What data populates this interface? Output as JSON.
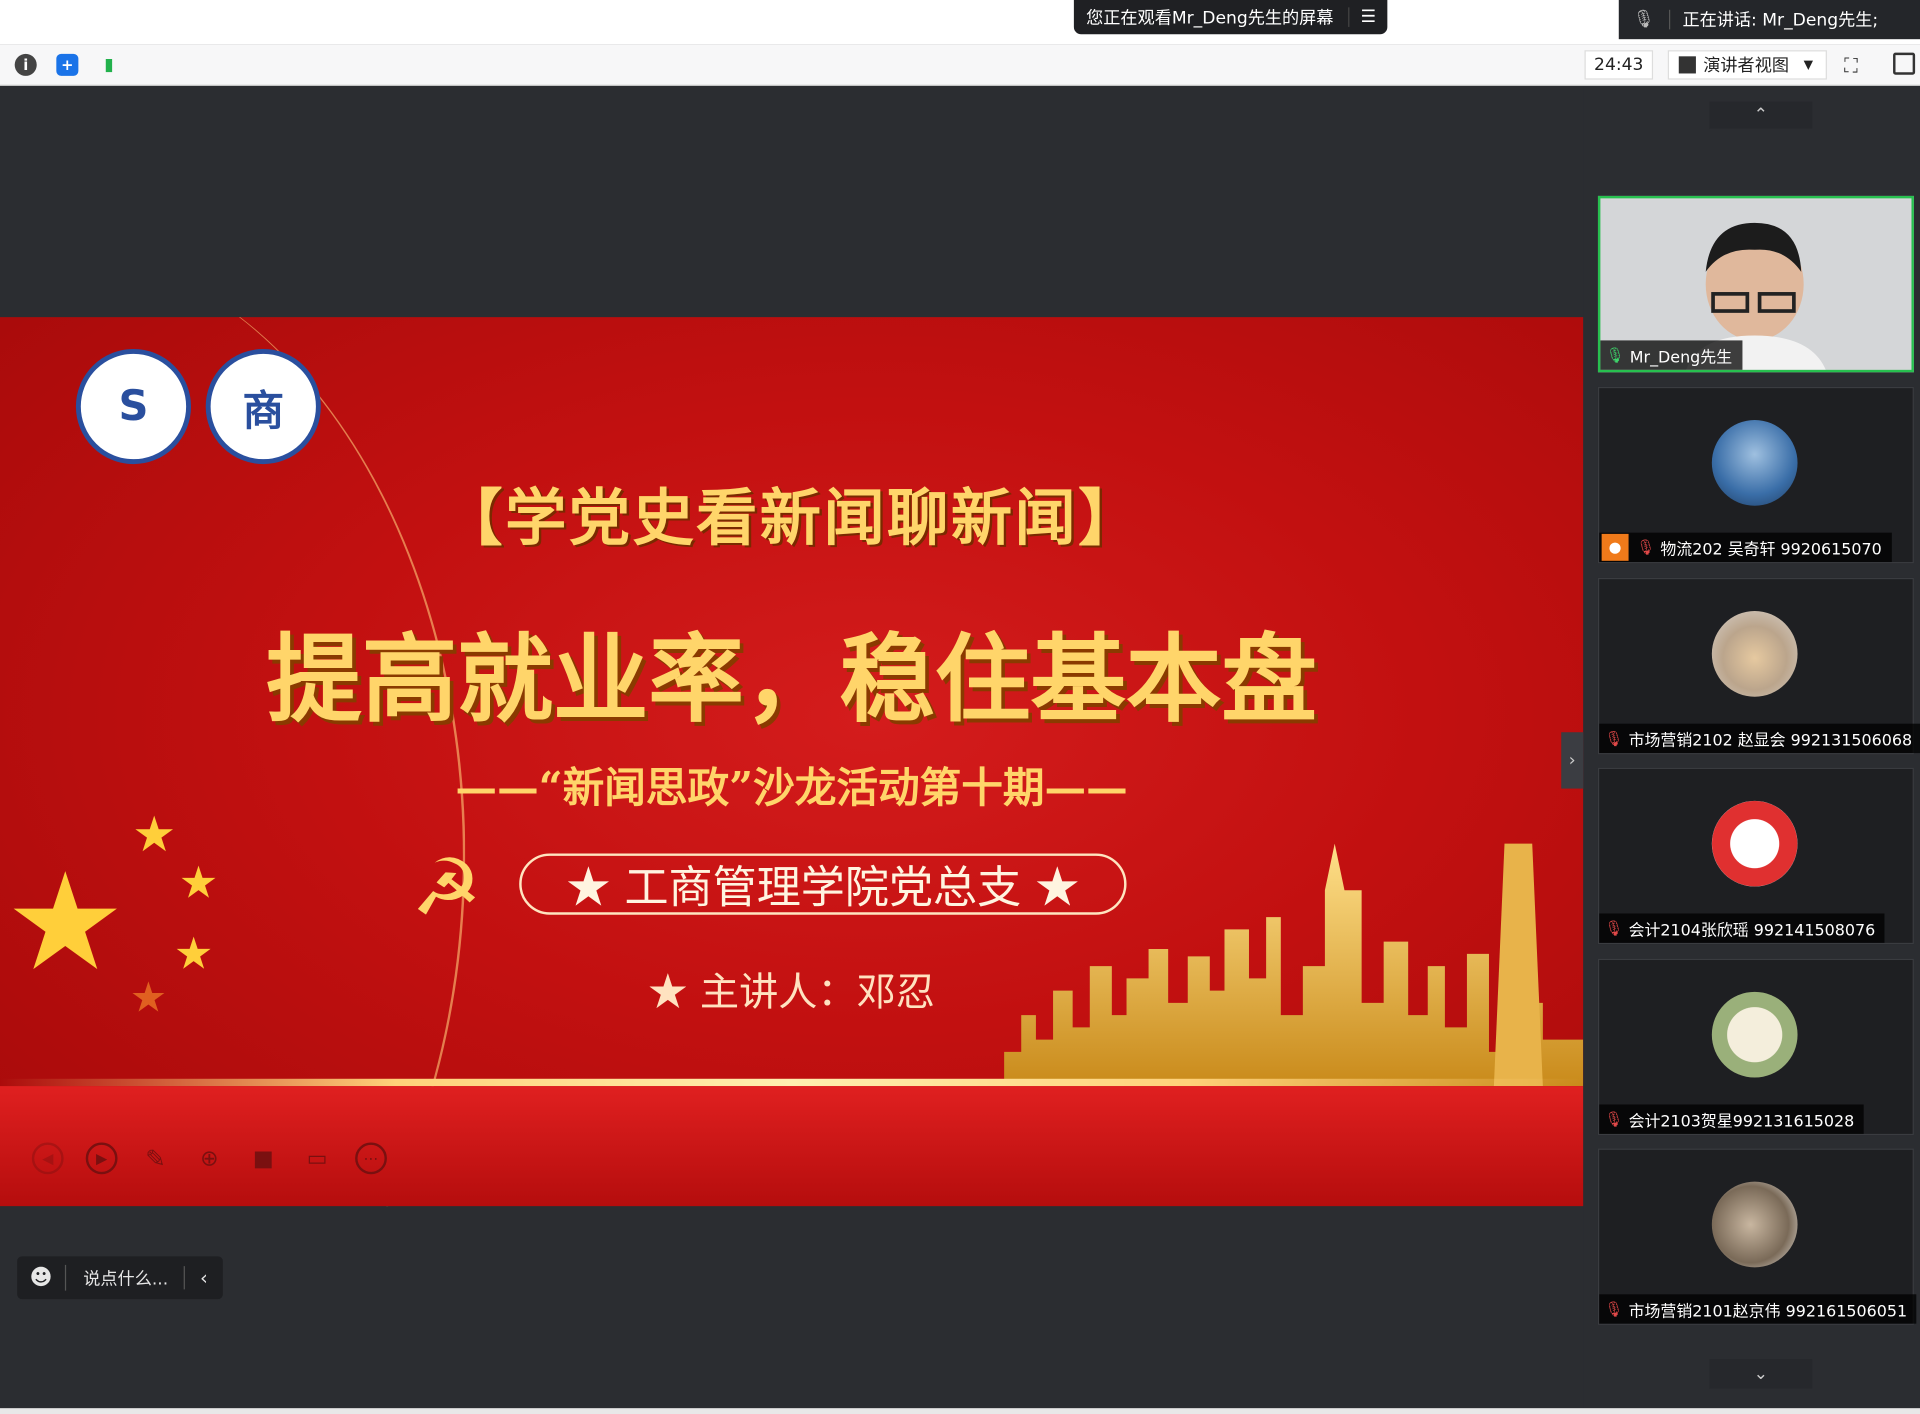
{
  "top": {
    "viewing_text": "您正在观看Mr_Deng先生的屏幕",
    "speaking_text": "正在讲话: Mr_Deng先生;"
  },
  "toolbar": {
    "timer": "24:43",
    "view_mode": "演讲者视图"
  },
  "slide": {
    "title": "【学党史看新闻聊新闻】",
    "headline": "提高就业率，稳住基本盘",
    "subtitle": "——“新闻思政”沙龙活动第十期——",
    "org": "★ 工商管理学院党总支 ★",
    "speaker": "★ 主讲人：邓忍"
  },
  "chat": {
    "placeholder": "说点什么..."
  },
  "participants": [
    {
      "name": "Mr_Deng先生",
      "muted": false,
      "active": true
    },
    {
      "name": "物流202 吴奇轩 9920615070",
      "muted": true,
      "host": true
    },
    {
      "name": "市场营销2102  赵显会 992131506068",
      "muted": true
    },
    {
      "name": "会计2104张欣瑶 992141508076",
      "muted": true
    },
    {
      "name": "会计2103贺星992131615028",
      "muted": true
    },
    {
      "name": "市场营销2101赵京伟 992161506051",
      "muted": true
    }
  ]
}
